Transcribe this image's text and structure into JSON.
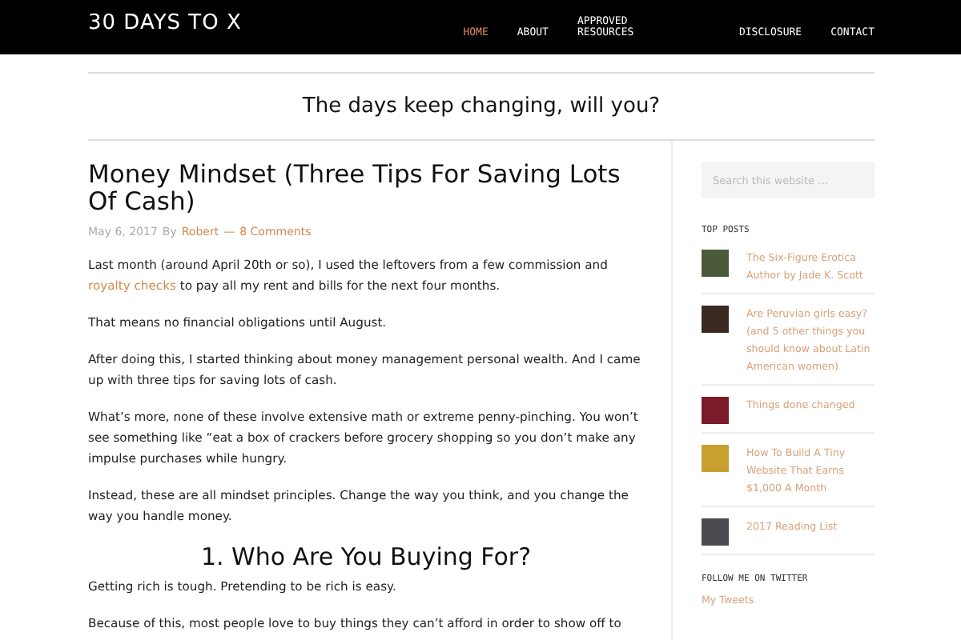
{
  "site_title": "30 DAYS TO X",
  "nav": [
    {
      "label": "HOME",
      "selected": true
    },
    {
      "label": "ABOUT",
      "selected": false
    },
    {
      "label": "APPROVED RESOURCES",
      "selected": false
    },
    {
      "label": "DISCLOSURE",
      "selected": false
    },
    {
      "label": "CONTACT",
      "selected": false
    }
  ],
  "tagline": "The days keep changing, will you?",
  "post": {
    "title": "Money Mindset (Three Tips For Saving Lots Of Cash)",
    "date": "May 6, 2017",
    "by": "By",
    "author": "Robert",
    "separator": "—",
    "comments": "8 Comments",
    "paragraphs": [
      {
        "before": "Last month (around April 20th or so), I used the leftovers from a few commission and ",
        "link": "royalty checks",
        "after": " to pay all my rent and bills for the next four months."
      },
      {
        "before": "That means no financial obligations until August."
      },
      {
        "before": "After doing this, I started thinking about money management personal wealth. And I came up with three tips for saving lots of cash."
      },
      {
        "before": "What’s more, none of these involve extensive math or extreme penny-pinching. You won’t see something like “eat a box of crackers before grocery shopping so you don’t make any impulse purchases while hungry."
      },
      {
        "before": "Instead, these are all mindset principles. Change the way you think, and you change the way you handle money."
      }
    ],
    "heading": "1. Who Are You Buying For?",
    "paragraphs_after": [
      "Getting rich is tough. Pretending to be rich is easy.",
      "Because of this, most people love to buy things they can’t afford in order to show off to"
    ]
  },
  "sidebar": {
    "search_placeholder": "Search this website …",
    "top_posts_title": "TOP POSTS",
    "top_posts": [
      {
        "title": "The Six-Figure Erotica Author by Jade K. Scott",
        "color": "#4a5a3a"
      },
      {
        "title": "Are Peruvian girls easy? (and 5 other things you should know about Latin American women)",
        "color": "#3a2a22"
      },
      {
        "title": "Things done changed",
        "color": "#7a1a2a"
      },
      {
        "title": "How To Build A Tiny Website That Earns $1,000 A Month",
        "color": "#c8a030"
      },
      {
        "title": "2017 Reading List",
        "color": "#4a4a50"
      }
    ],
    "twitter_title": "FOLLOW ME ON TWITTER",
    "twitter_link": "My Tweets"
  }
}
